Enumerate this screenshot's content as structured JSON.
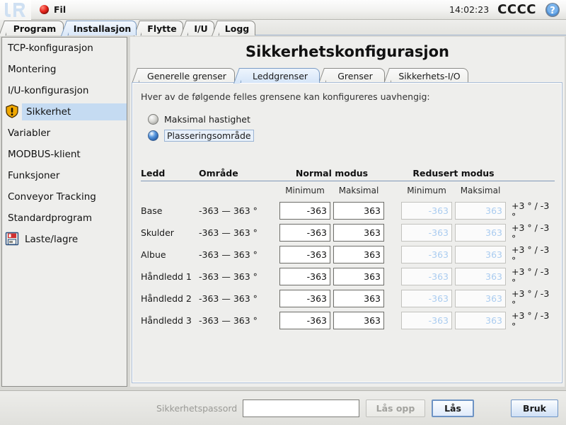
{
  "topbar": {
    "logo": "ur-logo",
    "file_menu_label": "Fil",
    "clock": "14:02:23",
    "robot_name": "CCCC",
    "help_icon": "help-circle-icon"
  },
  "main_tabs": [
    {
      "label": "Program",
      "active": false
    },
    {
      "label": "Installasjon",
      "active": true
    },
    {
      "label": "Flytte",
      "active": false
    },
    {
      "label": "I/U",
      "active": false
    },
    {
      "label": "Logg",
      "active": false
    }
  ],
  "sidebar": {
    "items": [
      {
        "label": "TCP-konfigurasjon",
        "icon": null,
        "selected": false
      },
      {
        "label": "Montering",
        "icon": null,
        "selected": false
      },
      {
        "label": "I/U-konfigurasjon",
        "icon": null,
        "selected": false
      },
      {
        "label": "Sikkerhet",
        "icon": "warning-shield-icon",
        "selected": true
      },
      {
        "label": "Variabler",
        "icon": null,
        "selected": false
      },
      {
        "label": "MODBUS-klient",
        "icon": null,
        "selected": false
      },
      {
        "label": "Funksjoner",
        "icon": null,
        "selected": false
      },
      {
        "label": "Conveyor Tracking",
        "icon": null,
        "selected": false
      },
      {
        "label": "Standardprogram",
        "icon": null,
        "selected": false
      },
      {
        "label": "Laste/lagre",
        "icon": "save-floppy-icon",
        "selected": false
      }
    ]
  },
  "content": {
    "title": "Sikkerhetskonfigurasjon",
    "tabs": [
      {
        "label": "Generelle grenser",
        "active": false
      },
      {
        "label": "Leddgrenser",
        "active": true
      },
      {
        "label": "Grenser",
        "active": false
      },
      {
        "label": "Sikkerhets-I/O",
        "active": false
      }
    ],
    "description": "Hver av de følgende felles grensene kan konfigureres uavhengig:",
    "radios": [
      {
        "label": "Maksimal hastighet",
        "selected": false,
        "focused": false
      },
      {
        "label": "Plasseringsområde",
        "selected": true,
        "focused": true
      }
    ],
    "table": {
      "headers": {
        "joint": "Ledd",
        "range": "Område",
        "normal_mode": "Normal modus",
        "reduced_mode": "Redusert modus"
      },
      "subheaders": {
        "minimum": "Minimum",
        "maksimal": "Maksimal"
      },
      "rows": [
        {
          "joint": "Base",
          "range": "-363 — 363 °",
          "normal_min": "-363",
          "normal_max": "363",
          "reduced_min": "-363",
          "reduced_max": "363",
          "tolerance": "+3 ° / -3 °"
        },
        {
          "joint": "Skulder",
          "range": "-363 — 363 °",
          "normal_min": "-363",
          "normal_max": "363",
          "reduced_min": "-363",
          "reduced_max": "363",
          "tolerance": "+3 ° / -3 °"
        },
        {
          "joint": "Albue",
          "range": "-363 — 363 °",
          "normal_min": "-363",
          "normal_max": "363",
          "reduced_min": "-363",
          "reduced_max": "363",
          "tolerance": "+3 ° / -3 °"
        },
        {
          "joint": "Håndledd 1",
          "range": "-363 — 363 °",
          "normal_min": "-363",
          "normal_max": "363",
          "reduced_min": "-363",
          "reduced_max": "363",
          "tolerance": "+3 ° / -3 °"
        },
        {
          "joint": "Håndledd 2",
          "range": "-363 — 363 °",
          "normal_min": "-363",
          "normal_max": "363",
          "reduced_min": "-363",
          "reduced_max": "363",
          "tolerance": "+3 ° / -3 °"
        },
        {
          "joint": "Håndledd 3",
          "range": "-363 — 363 °",
          "normal_min": "-363",
          "normal_max": "363",
          "reduced_min": "-363",
          "reduced_max": "363",
          "tolerance": "+3 ° / -3 °"
        }
      ]
    }
  },
  "bottombar": {
    "password_label": "Sikkerhetspassord",
    "password_value": "",
    "password_placeholder": "",
    "unlock_label": "Lås opp",
    "unlock_disabled": true,
    "lock_label": "Lås",
    "lock_focused": true,
    "apply_label": "Bruk"
  },
  "colors": {
    "accent_blue": "#c5dbf2",
    "tab_active": "#d5e5f8",
    "panel_bg": "#eeeeec",
    "disabled_text": "#aaccf0",
    "warning_yellow": "#f5b301"
  }
}
